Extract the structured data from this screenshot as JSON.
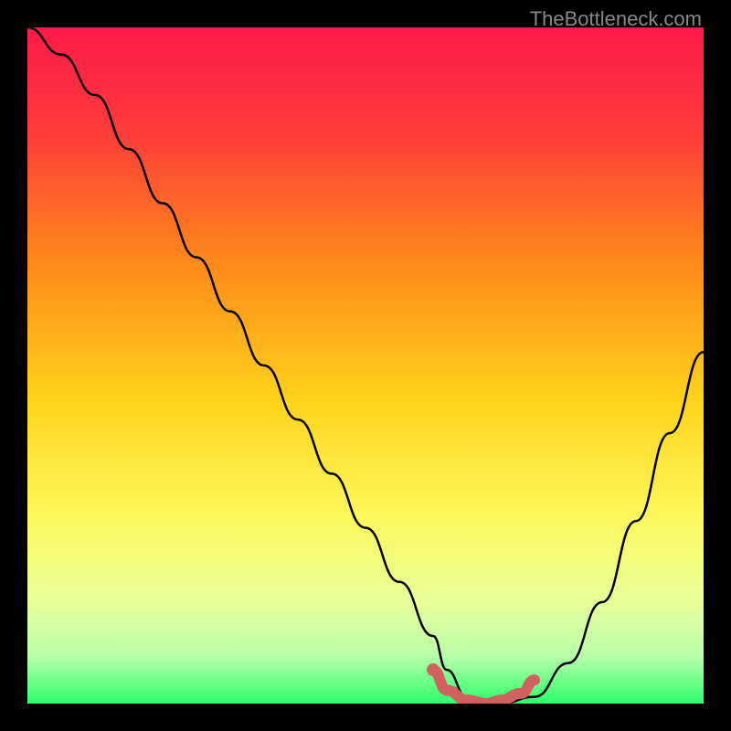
{
  "watermark": "TheBottleneck.com",
  "chart_data": {
    "type": "line",
    "title": "",
    "xlabel": "",
    "ylabel": "",
    "xlim": [
      0,
      100
    ],
    "ylim": [
      0,
      100
    ],
    "series": [
      {
        "name": "bottleneck-curve",
        "x": [
          0,
          5,
          10,
          15,
          20,
          25,
          30,
          35,
          40,
          45,
          50,
          55,
          60,
          62,
          65,
          68,
          70,
          75,
          80,
          85,
          90,
          95,
          100
        ],
        "values": [
          100,
          96,
          90,
          82,
          74,
          66,
          58,
          50,
          42,
          34,
          26,
          18,
          10,
          5,
          1,
          0,
          0,
          1,
          6,
          15,
          27,
          40,
          52
        ]
      },
      {
        "name": "optimal-zone-highlight",
        "x": [
          60,
          62,
          65,
          68,
          70,
          73,
          75
        ],
        "values": [
          5,
          2,
          0.5,
          0,
          0.5,
          1.5,
          3.5
        ]
      }
    ],
    "gradient_stops": [
      {
        "offset": 0,
        "color": "#ff1a4a"
      },
      {
        "offset": 15,
        "color": "#ff3a3a"
      },
      {
        "offset": 35,
        "color": "#ff8a1a"
      },
      {
        "offset": 55,
        "color": "#ffd21a"
      },
      {
        "offset": 72,
        "color": "#fdf85a"
      },
      {
        "offset": 85,
        "color": "#e8ff9a"
      },
      {
        "offset": 93,
        "color": "#b8ffaa"
      },
      {
        "offset": 100,
        "color": "#2cff6a"
      }
    ],
    "highlight_color": "#d1605e",
    "curve_color": "#000000"
  }
}
